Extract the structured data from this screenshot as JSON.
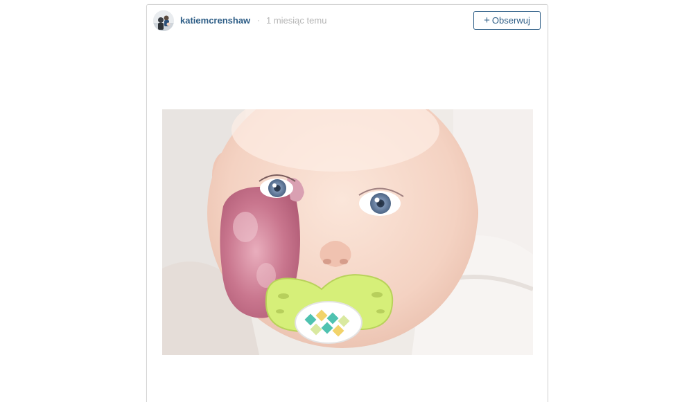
{
  "post": {
    "author": {
      "username": "katiemcrenshaw",
      "avatar_icon": "user-avatar-photo"
    },
    "separator": "·",
    "timestamp": "1 miesiąc temu",
    "follow_button": {
      "icon": "plus-icon",
      "plus_glyph": "+",
      "label": "Obserwuj"
    },
    "image": {
      "alt": "baby with pacifier"
    }
  },
  "colors": {
    "brand": "#2d5d86",
    "muted": "#b5b5b5",
    "border": "#d5d5d5"
  }
}
